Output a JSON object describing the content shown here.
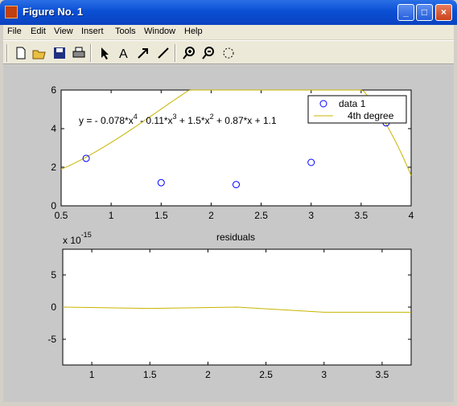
{
  "window": {
    "title": "Figure No. 1",
    "app_icon": "matlab-icon"
  },
  "title_buttons": {
    "minimize": "minimize-icon",
    "maximize": "maximize-icon",
    "close": "close-icon"
  },
  "menu": [
    "File",
    "Edit",
    "View",
    "Insert",
    "Tools",
    "Window",
    "Help"
  ],
  "toolbar": [
    "new-figure-icon",
    "open-icon",
    "save-icon",
    "print-icon",
    "select-arrow-icon",
    "text-icon",
    "arrow-icon",
    "line-icon",
    "zoom-in-icon",
    "zoom-out-icon",
    "rotate-icon"
  ],
  "chart_data": [
    {
      "type": "scatter+line",
      "equation": "y = - 0.078*x^4 - 0.11*x^3 + 1.5*x^2 + 0.87*x + 1.1",
      "eq_parts": {
        "p1": "y = - 0.078*x",
        "e1": "4",
        "p2": " - 0.11*x",
        "e2": "3",
        "p3": " + 1.5*x",
        "e3": "2",
        "p4": " + 0.87*x + 1.1"
      },
      "xlim": [
        0.5,
        4
      ],
      "ylim": [
        0,
        6
      ],
      "xticks": [
        "0.5",
        "1",
        "1.5",
        "2",
        "2.5",
        "3",
        "3.5",
        "4"
      ],
      "yticks": [
        "0",
        "2",
        "4",
        "6"
      ],
      "series": [
        {
          "name": "data 1",
          "style": "markers",
          "color": "#0000ff",
          "x": [
            0.75,
            1.5,
            2.25,
            3.0,
            3.75
          ],
          "y": [
            2.46,
            1.2,
            1.1,
            2.25,
            4.3
          ]
        },
        {
          "name": "4th degree",
          "style": "line",
          "color": "#c8b400",
          "coefficients": [
            -0.078,
            -0.11,
            1.5,
            0.87,
            1.1
          ]
        }
      ],
      "legend": [
        "data 1",
        "4th degree"
      ],
      "legend_position": "top-right"
    },
    {
      "type": "line",
      "title": "residuals",
      "exponent_label": "x 10",
      "exponent_power": "-15",
      "xlim": [
        0.75,
        3.75
      ],
      "ylim": [
        -9,
        9
      ],
      "xticks": [
        "1",
        "1.5",
        "2",
        "2.5",
        "3",
        "3.5"
      ],
      "yticks": [
        "-5",
        "0",
        "5"
      ],
      "series": [
        {
          "color": "#c8b400",
          "x": [
            0.75,
            1.5,
            2.25,
            3.0,
            3.75
          ],
          "y": [
            0.0,
            -0.2,
            0.0,
            -0.8,
            -0.8
          ]
        }
      ]
    }
  ]
}
